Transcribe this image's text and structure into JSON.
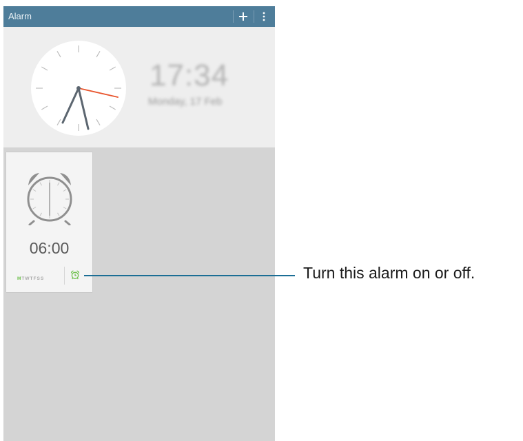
{
  "app_bar": {
    "title": "Alarm",
    "icons": [
      "add-icon",
      "more-options-icon"
    ]
  },
  "clock": {
    "time": "17:34",
    "date": "Monday, 17 Feb"
  },
  "alarms": [
    {
      "time": "06:00",
      "days": [
        "M",
        "T",
        "W",
        "T",
        "F",
        "S",
        "S"
      ],
      "active_day_index": 0,
      "status_icon": "alarm-clock-icon"
    }
  ],
  "callout": {
    "text": "Turn this alarm on or off."
  },
  "colors": {
    "app_bar": "#4e7d9a",
    "second_hand": "#e8532b",
    "active_green": "#6cbf4a",
    "callout_line": "#1c6e95"
  }
}
